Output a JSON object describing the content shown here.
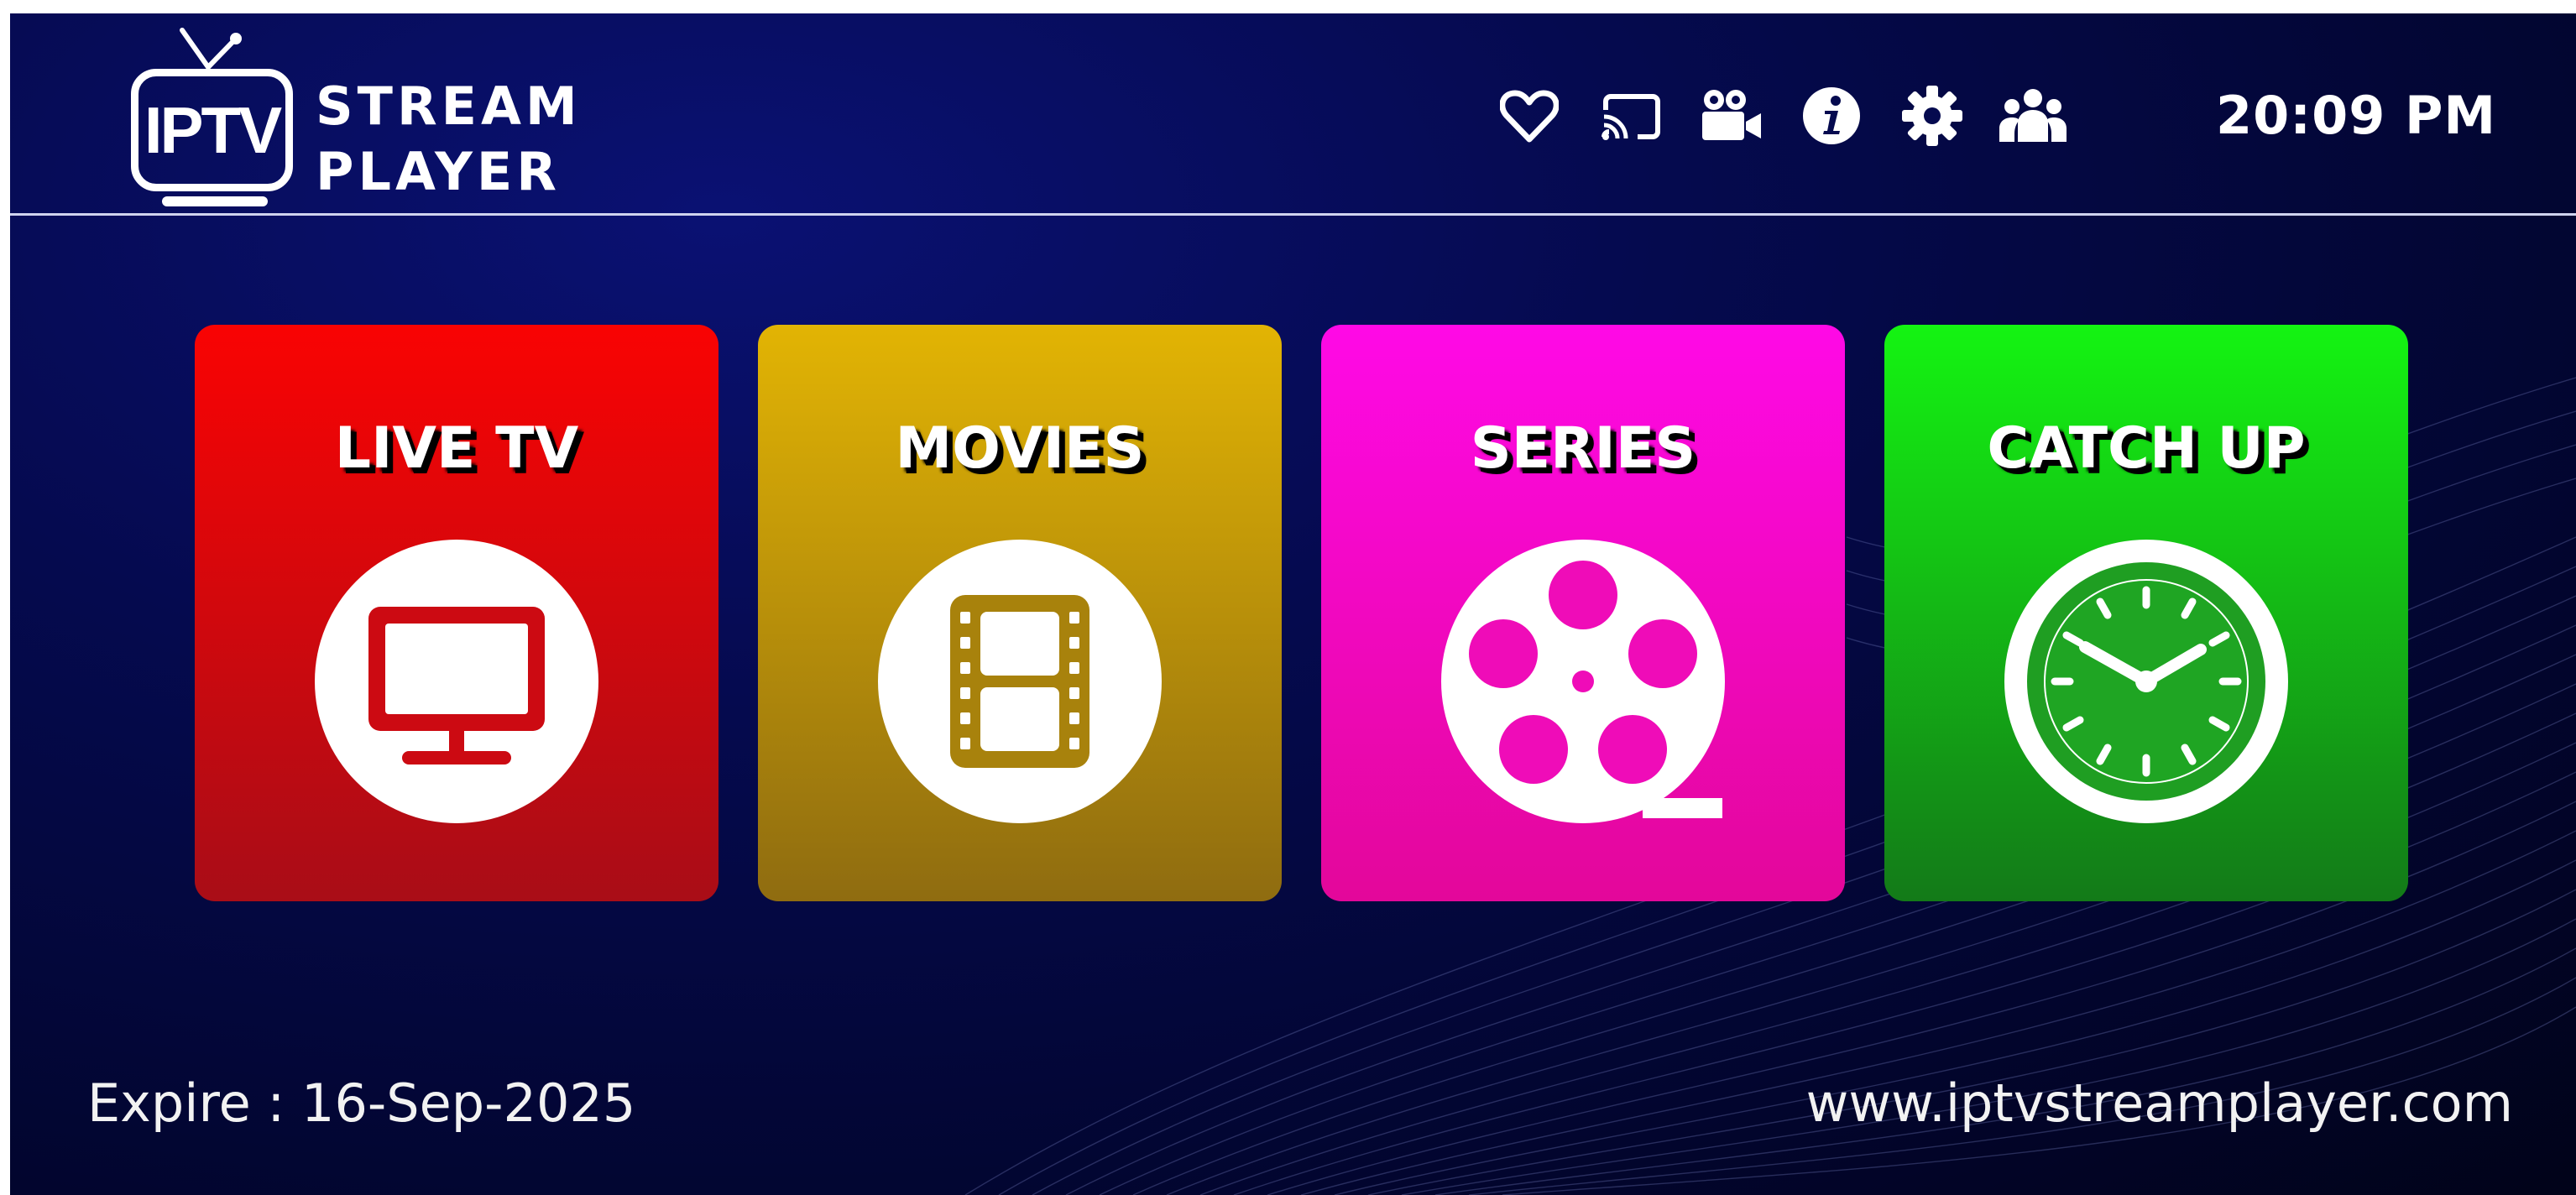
{
  "app": {
    "logo": {
      "badge": "IPTV",
      "line1": "STREAM",
      "line2": "PLAYER"
    },
    "time": "20:09 PM"
  },
  "header": {
    "icons": [
      {
        "name": "favorites-heart-icon"
      },
      {
        "name": "cast-icon"
      },
      {
        "name": "video-camera-icon"
      },
      {
        "name": "info-icon"
      },
      {
        "name": "settings-gear-icon"
      },
      {
        "name": "users-icon"
      }
    ]
  },
  "tiles": [
    {
      "label": "LIVE TV",
      "icon": "tv-monitor-icon",
      "color_top": "#f90303",
      "color_bottom": "#a90d17"
    },
    {
      "label": "MOVIES",
      "icon": "film-strip-icon",
      "color_top": "#e2b404",
      "color_bottom": "#8f6c10"
    },
    {
      "label": "SERIES",
      "icon": "film-reel-icon",
      "color_top": "#ff09e6",
      "color_bottom": "#e3079a"
    },
    {
      "label": "CATCH UP",
      "icon": "clock-icon",
      "color_top": "#14f412",
      "color_bottom": "#137a18"
    }
  ],
  "footer": {
    "expire": "Expire : 16-Sep-2025",
    "website": "www.iptvstreamplayer.com"
  },
  "colors": {
    "background": "#050a4f",
    "accent_white": "#ffffff"
  }
}
